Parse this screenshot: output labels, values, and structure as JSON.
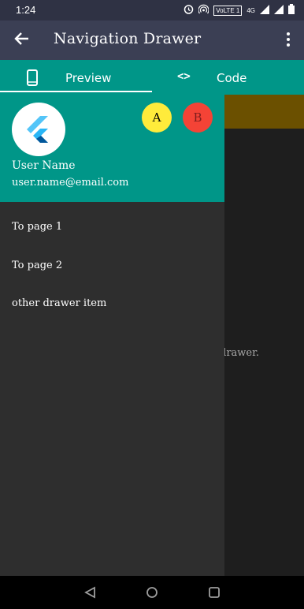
{
  "status_bar": {
    "time": "1:24",
    "volte": "VoLTE 1",
    "network": "4G"
  },
  "app_bar": {
    "title": "Navigation Drawer"
  },
  "tabs": [
    {
      "label": "Preview",
      "icon": "phone-icon",
      "selected": true
    },
    {
      "label": "Code",
      "icon": "code-icon",
      "selected": false
    }
  ],
  "drawer": {
    "account_name": "User Name",
    "account_email": "user.name@email.com",
    "other_accounts": [
      "A",
      "B"
    ],
    "items": [
      "To page 1",
      "To page 2",
      "other drawer item"
    ]
  },
  "background": {
    "body_text": "drawer."
  },
  "colors": {
    "app_bar": "#3b3f54",
    "tab_bar": "#009688",
    "drawer_header": "#009688",
    "drawer_body": "#2e2e2e",
    "account_a": "#ffeb3b",
    "account_b": "#f44336"
  }
}
